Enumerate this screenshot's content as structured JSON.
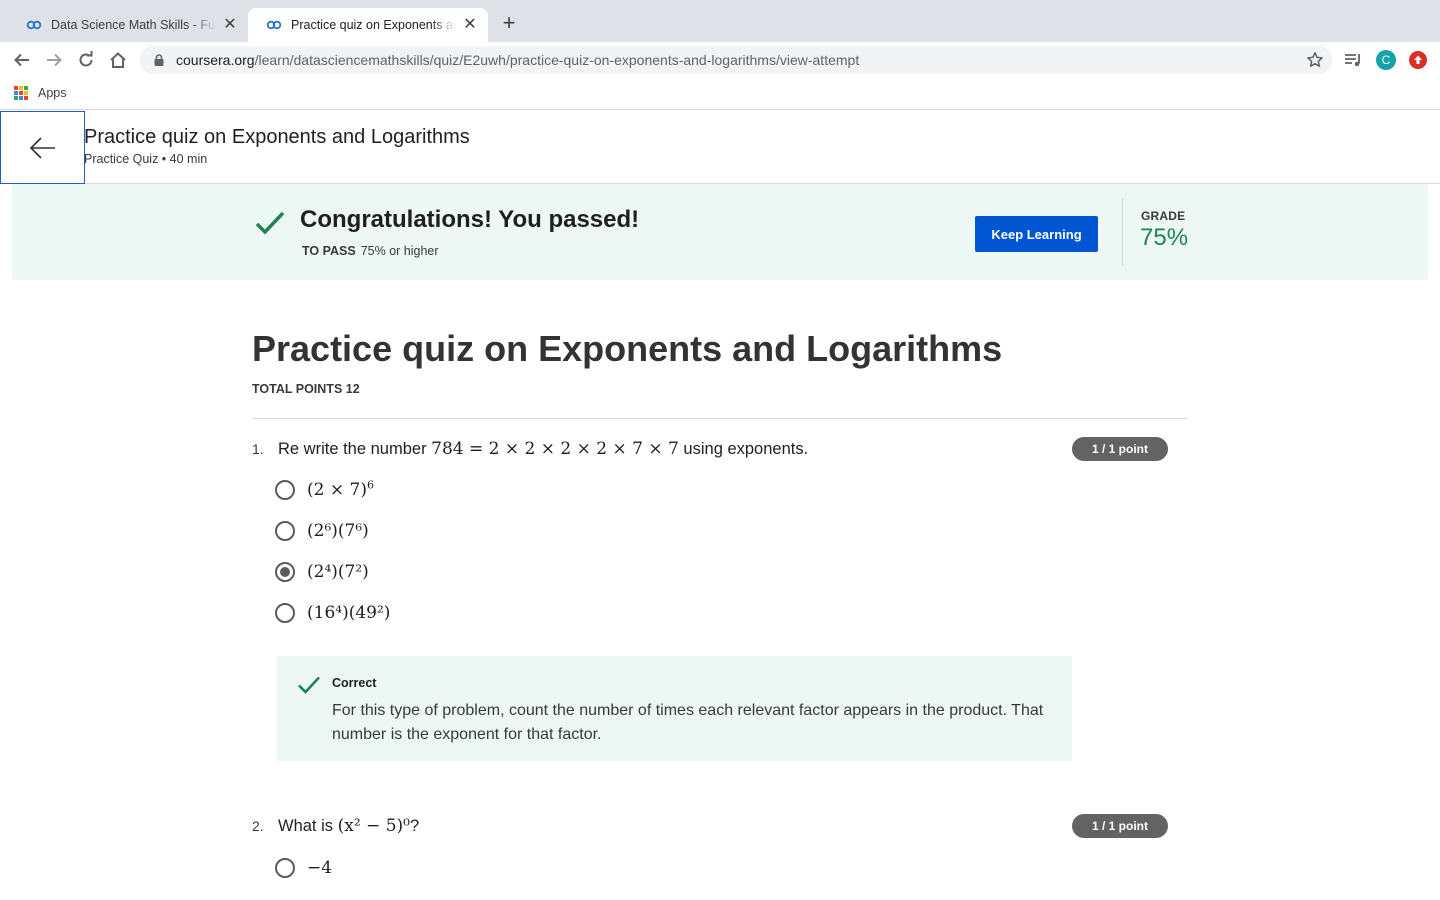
{
  "browser": {
    "tabs": [
      {
        "title": "Data Science Math Skills - Fundamentals",
        "active": false
      },
      {
        "title": "Practice quiz on Exponents and Logarithms",
        "active": true
      }
    ],
    "url_host": "coursera.org",
    "url_path": "/learn/datasciencemathskills/quiz/E2uwh/practice-quiz-on-exponents-and-logarithms/view-attempt",
    "bookmarks": {
      "apps_label": "Apps"
    },
    "profile_initial": "C"
  },
  "header": {
    "title": "Practice quiz on Exponents and Logarithms",
    "subtitle": "Practice Quiz • 40 min"
  },
  "banner": {
    "message": "Congratulations! You passed!",
    "to_pass_label": "TO PASS",
    "to_pass_value": "75% or higher",
    "button_label": "Keep Learning",
    "grade_label": "GRADE",
    "grade_value": "75%",
    "colors": {
      "accent": "#1f8354",
      "button": "#0056d2",
      "background": "#edf7f3"
    }
  },
  "quiz": {
    "title": "Practice quiz on Exponents and Logarithms",
    "total_points": "TOTAL POINTS 12",
    "questions": [
      {
        "number": "1.",
        "prompt_prefix": "Re write the number",
        "prompt_math": "784 = 2 × 2 × 2 × 2 × 7 × 7",
        "prompt_suffix": "using exponents.",
        "points": "1 / 1 point",
        "options": [
          {
            "label": "(2 × 7)",
            "exp": "6",
            "selected": false
          },
          {
            "label": "(2⁶)(7⁶)",
            "selected": false
          },
          {
            "label": "(2⁴)(7²)",
            "selected": true
          },
          {
            "label": "(16⁴)(49²)",
            "selected": false
          }
        ],
        "feedback": {
          "label": "Correct",
          "text": "For this type of problem, count the number of times each relevant factor appears in the product. That number is the exponent for that factor."
        }
      },
      {
        "number": "2.",
        "prompt_prefix": "What is",
        "prompt_math": "(x² − 5)⁰",
        "prompt_suffix": "?",
        "points": "1 / 1 point",
        "options": [
          {
            "label": "−4",
            "selected": false
          }
        ]
      }
    ]
  }
}
